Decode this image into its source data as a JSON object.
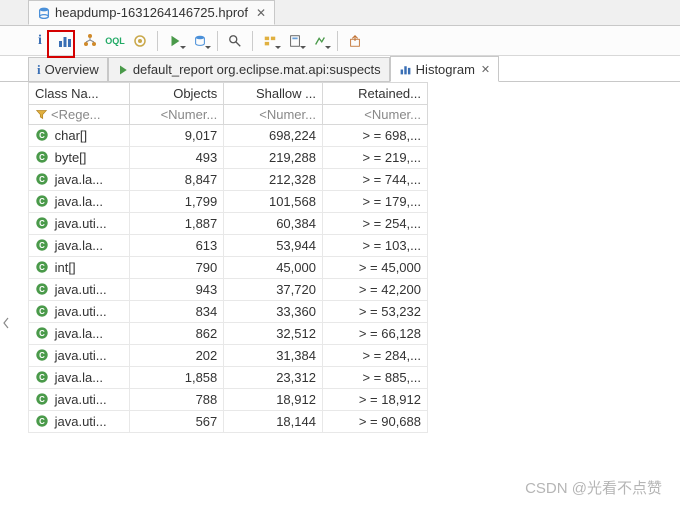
{
  "editor": {
    "tab_title": "heapdump-1631264146725.hprof"
  },
  "toolbar": {
    "info": "i",
    "histogram": "histogram-icon",
    "tree": "tree-icon",
    "oql": "OQL",
    "gear": "gear-icon",
    "run": "run-icon",
    "db": "db-icon",
    "search": "search-icon",
    "folders": "folder-icon",
    "calc": "calc-icon",
    "chart": "chart-icon",
    "export": "export-icon"
  },
  "tabs": [
    {
      "icon": "info",
      "label": "Overview"
    },
    {
      "icon": "run",
      "label": "default_report  org.eclipse.mat.api:suspects"
    },
    {
      "icon": "histogram",
      "label": "Histogram",
      "active": true
    }
  ],
  "columns": {
    "class": "Class Na...",
    "objects": "Objects",
    "shallow": "Shallow ...",
    "retained": "Retained..."
  },
  "filter": {
    "class": "<Rege...",
    "objects": "<Numer...",
    "shallow": "<Numer...",
    "retained": "<Numer..."
  },
  "rows": [
    {
      "class": "char[]",
      "objects": "9,017",
      "shallow": "698,224",
      "retained": "> = 698,..."
    },
    {
      "class": "byte[]",
      "objects": "493",
      "shallow": "219,288",
      "retained": "> = 219,..."
    },
    {
      "class": "java.la...",
      "objects": "8,847",
      "shallow": "212,328",
      "retained": "> = 744,..."
    },
    {
      "class": "java.la...",
      "objects": "1,799",
      "shallow": "101,568",
      "retained": "> = 179,..."
    },
    {
      "class": "java.uti...",
      "objects": "1,887",
      "shallow": "60,384",
      "retained": "> = 254,..."
    },
    {
      "class": "java.la...",
      "objects": "613",
      "shallow": "53,944",
      "retained": "> = 103,..."
    },
    {
      "class": "int[]",
      "objects": "790",
      "shallow": "45,000",
      "retained": "> = 45,000"
    },
    {
      "class": "java.uti...",
      "objects": "943",
      "shallow": "37,720",
      "retained": "> = 42,200"
    },
    {
      "class": "java.uti...",
      "objects": "834",
      "shallow": "33,360",
      "retained": "> = 53,232"
    },
    {
      "class": "java.la...",
      "objects": "862",
      "shallow": "32,512",
      "retained": "> = 66,128"
    },
    {
      "class": "java.uti...",
      "objects": "202",
      "shallow": "31,384",
      "retained": "> = 284,..."
    },
    {
      "class": "java.la...",
      "objects": "1,858",
      "shallow": "23,312",
      "retained": "> = 885,..."
    },
    {
      "class": "java.uti...",
      "objects": "788",
      "shallow": "18,912",
      "retained": "> = 18,912"
    },
    {
      "class": "java.uti...",
      "objects": "567",
      "shallow": "18,144",
      "retained": "> = 90,688"
    }
  ],
  "watermark": "CSDN @光看不点赞"
}
